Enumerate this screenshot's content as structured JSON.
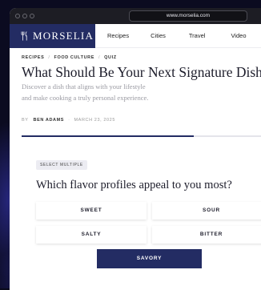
{
  "browser": {
    "url": "www.morselia.com"
  },
  "brand": {
    "name": "MORSELIA",
    "logo_icon": "fork-knife-icon"
  },
  "nav": {
    "items": [
      "Recipes",
      "Cities",
      "Travel",
      "Video"
    ]
  },
  "breadcrumb": [
    "RECIPES",
    "FOOD CULTURE",
    "QUIZ"
  ],
  "article": {
    "title": "What Should Be Your Next Signature Dish?",
    "description_line1": "Discover a dish that aligns with your lifestyle",
    "description_line2": "and make cooking a truly personal experience.",
    "by_label": "BY",
    "author": "BEN ADAMS",
    "date": "MARCH 23, 2025"
  },
  "quiz": {
    "progress_fraction": 0.69,
    "badge": "SELECT MULTIPLE",
    "question": "Which flavor profiles appeal to you most?",
    "options": [
      "SWEET",
      "SOUR",
      "SALTY",
      "BITTER",
      "SAVORY"
    ],
    "selected": [
      "SAVORY"
    ]
  },
  "colors": {
    "brand": "#232c63",
    "background": "#0b0b20"
  }
}
